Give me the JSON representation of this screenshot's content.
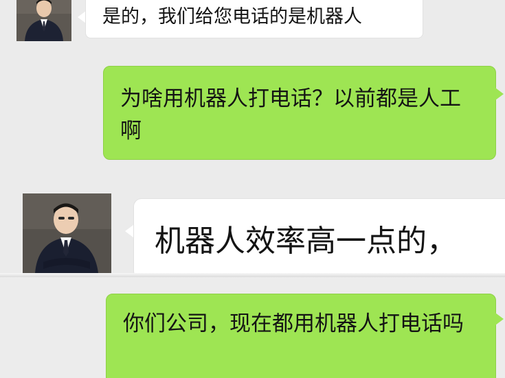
{
  "conversation": {
    "messages": [
      {
        "sender": "agent",
        "avatar_icon": "person-in-suit-avatar",
        "text": "是的，我们给您电话的是机器人"
      },
      {
        "sender": "self",
        "text": "为啥用机器人打电话？以前都是人工啊"
      },
      {
        "sender": "agent",
        "avatar_icon": "person-in-suit-avatar",
        "text": "机器人效率高一点的，"
      },
      {
        "sender": "self",
        "text": "你们公司，现在都用机器人打电话吗"
      }
    ]
  },
  "colors": {
    "background": "#ebebeb",
    "incoming_bubble": "#ffffff",
    "outgoing_bubble": "#9ee553",
    "text": "#141414"
  }
}
